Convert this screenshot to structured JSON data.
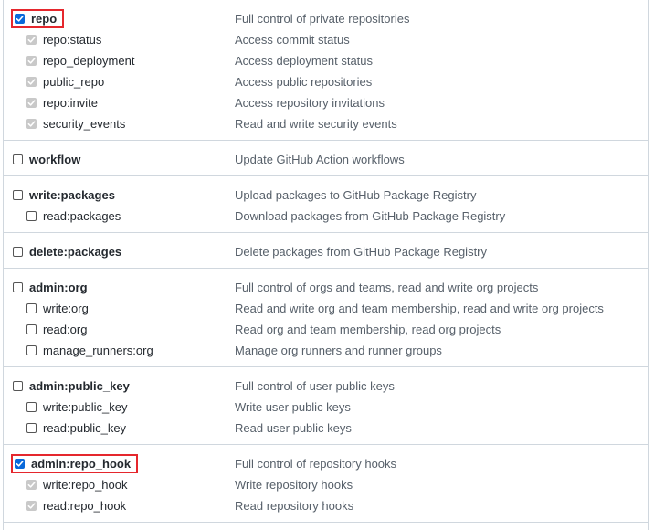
{
  "scopes": [
    {
      "name": "repo",
      "description": "Full control of private repositories",
      "checked": true,
      "highlight": true,
      "children": [
        {
          "name": "repo:status",
          "description": "Access commit status",
          "checked": true,
          "disabled": true
        },
        {
          "name": "repo_deployment",
          "description": "Access deployment status",
          "checked": true,
          "disabled": true
        },
        {
          "name": "public_repo",
          "description": "Access public repositories",
          "checked": true,
          "disabled": true
        },
        {
          "name": "repo:invite",
          "description": "Access repository invitations",
          "checked": true,
          "disabled": true
        },
        {
          "name": "security_events",
          "description": "Read and write security events",
          "checked": true,
          "disabled": true
        }
      ]
    },
    {
      "name": "workflow",
      "description": "Update GitHub Action workflows",
      "checked": false,
      "highlight": false,
      "children": []
    },
    {
      "name": "write:packages",
      "description": "Upload packages to GitHub Package Registry",
      "checked": false,
      "highlight": false,
      "children": [
        {
          "name": "read:packages",
          "description": "Download packages from GitHub Package Registry",
          "checked": false,
          "disabled": false
        }
      ]
    },
    {
      "name": "delete:packages",
      "description": "Delete packages from GitHub Package Registry",
      "checked": false,
      "highlight": false,
      "children": []
    },
    {
      "name": "admin:org",
      "description": "Full control of orgs and teams, read and write org projects",
      "checked": false,
      "highlight": false,
      "children": [
        {
          "name": "write:org",
          "description": "Read and write org and team membership, read and write org projects",
          "checked": false,
          "disabled": false
        },
        {
          "name": "read:org",
          "description": "Read org and team membership, read org projects",
          "checked": false,
          "disabled": false
        },
        {
          "name": "manage_runners:org",
          "description": "Manage org runners and runner groups",
          "checked": false,
          "disabled": false
        }
      ]
    },
    {
      "name": "admin:public_key",
      "description": "Full control of user public keys",
      "checked": false,
      "highlight": false,
      "children": [
        {
          "name": "write:public_key",
          "description": "Write user public keys",
          "checked": false,
          "disabled": false
        },
        {
          "name": "read:public_key",
          "description": "Read user public keys",
          "checked": false,
          "disabled": false
        }
      ]
    },
    {
      "name": "admin:repo_hook",
      "description": "Full control of repository hooks",
      "checked": true,
      "highlight": true,
      "children": [
        {
          "name": "write:repo_hook",
          "description": "Write repository hooks",
          "checked": true,
          "disabled": true
        },
        {
          "name": "read:repo_hook",
          "description": "Read repository hooks",
          "checked": true,
          "disabled": true
        }
      ]
    }
  ],
  "colors": {
    "checkbox_checked": "#0969da",
    "checkbox_disabled": "#c9c9c9",
    "highlight_border": "#e5272d",
    "divider": "#d0d7de",
    "description_text": "#57606a",
    "scope_text": "#24292f"
  }
}
